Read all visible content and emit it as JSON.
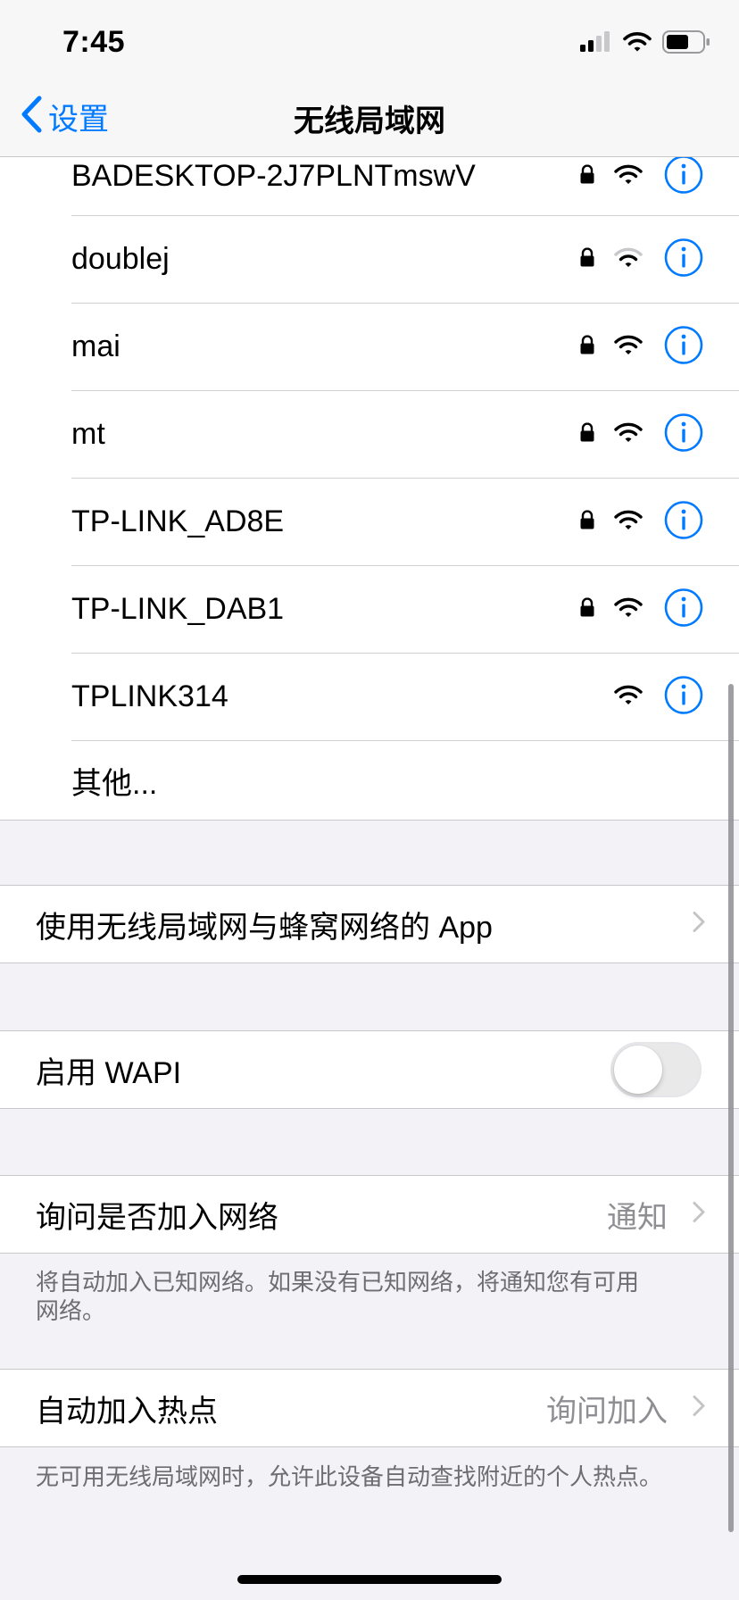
{
  "status_bar": {
    "time": "7:45",
    "icons": [
      "cellular-signal-icon",
      "wifi-icon",
      "battery-icon"
    ]
  },
  "nav": {
    "back_label": "设置",
    "title": "无线局域网"
  },
  "networks": [
    {
      "name": "BADESKTOP-2J7PLNTmswV",
      "locked": true,
      "signal": "full"
    },
    {
      "name": "doublej",
      "locked": true,
      "signal": "weak"
    },
    {
      "name": "mai",
      "locked": true,
      "signal": "full"
    },
    {
      "name": "mt",
      "locked": true,
      "signal": "full"
    },
    {
      "name": "TP-LINK_AD8E",
      "locked": true,
      "signal": "full"
    },
    {
      "name": "TP-LINK_DAB1",
      "locked": true,
      "signal": "full"
    },
    {
      "name": "TPLINK314",
      "locked": false,
      "signal": "full"
    }
  ],
  "other_label": "其他...",
  "apps_cell": {
    "label": "使用无线局域网与蜂窝网络的 App"
  },
  "wapi_cell": {
    "label": "启用 WAPI",
    "enabled": false
  },
  "ask_join": {
    "label": "询问是否加入网络",
    "value": "通知",
    "footnote": "将自动加入已知网络。如果没有已知网络，将通知您有可用网络。"
  },
  "auto_hotspot": {
    "label": "自动加入热点",
    "value": "询问加入",
    "footnote": "无可用无线局域网时，允许此设备自动查找附近的个人热点。"
  },
  "colors": {
    "accent": "#007aff",
    "background": "#f2f2f7",
    "secondary_text": "#8e8e93"
  }
}
